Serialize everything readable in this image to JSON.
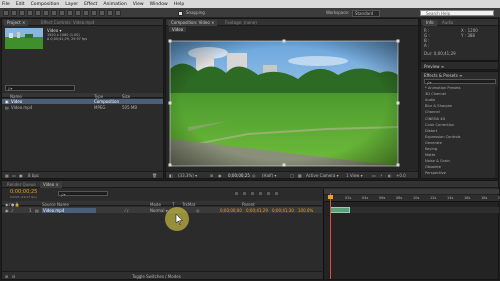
{
  "menu": [
    "File",
    "Edit",
    "Composition",
    "Layer",
    "Effect",
    "Animation",
    "View",
    "Window",
    "Help"
  ],
  "toolbar": {
    "snapping": "Snapping",
    "workspace_label": "Workspace:",
    "workspace_value": "Standard",
    "search_placeholder": "Search Help"
  },
  "project": {
    "tab": "Project ×",
    "effect_controls_tab": "Effect Controls: Video.mp4",
    "item_name": "Video ▾",
    "item_info1": "1920 x 1080 (1.00)",
    "item_info2": "Δ 0;00;41;29, 29.97 fps",
    "search_placeholder": "ρ▾",
    "col_name": "Name",
    "col_type": "Type",
    "col_size": "Size",
    "items": [
      {
        "name": "Video",
        "type": "Composition",
        "size": "",
        "selected": true
      },
      {
        "name": "Video.mp4",
        "type": "MPEG",
        "size": "505 MB",
        "selected": false
      }
    ],
    "footer": "8 bpc"
  },
  "composition": {
    "tab": "Composition: Video ×",
    "layer_tab": "Footage: (none)",
    "comp_name": "Video",
    "zoom": "(33.3%) ▾",
    "timecode": "0;00;00;25",
    "resolution": "(Half) ▾",
    "camera": "Active Camera ▾",
    "views": "1 View ▾",
    "offset": "+0.0"
  },
  "info": {
    "tab": "Info",
    "audio_tab": "Audio",
    "r": "R :",
    "g": "G :",
    "b": "B :",
    "a": "A :",
    "x": "X : 1200",
    "y": "Y : 388",
    "dur": "Dur: 0;00;41;29",
    "preview_tab": "Preview ≡"
  },
  "effects": {
    "tab": "Effects & Presets ≡",
    "search": "ρ▾",
    "items": [
      "* Animation Presets",
      "3D Channel",
      "Audio",
      "Blur & Sharpen",
      "Channel",
      "CINEMA 4D",
      "Color Correction",
      "Distort",
      "Expression Controls",
      "Generate",
      "Keying",
      "Matte",
      "Noise & Grain",
      "Obsolete",
      "Perspective"
    ]
  },
  "render_tab": "Render Queue",
  "timeline": {
    "tab": "Video ×",
    "timecode": "0;00;00;25",
    "fps": "00025 (29.97 fps)",
    "search": "ρ▾",
    "col_source": "Source Name",
    "col_mode": "Mode",
    "col_t": "T",
    "col_trkmat": "TrkMat",
    "col_parent": "Parent",
    "layer_index": "1",
    "layer_name": "Video.mp4",
    "layer_mode": "Normal ▾",
    "parent": "None ▾",
    "in": "0;00;00;00",
    "out": "0;00;41;29",
    "dur": "0;00;41;30",
    "stretch": "100.0%",
    "ruler": [
      "0s",
      "02s",
      "04s",
      "06s",
      "08s",
      "10s",
      "12s",
      "14s",
      "16s",
      "18s",
      "20s"
    ],
    "footer": "Toggle Switches / Modes"
  },
  "colors": {
    "accent": "#e8a228",
    "menubar": "#d9d9d9",
    "panel": "#2b2b2b",
    "selection": "#4b5e7a",
    "clip": "#5a9e7a"
  }
}
